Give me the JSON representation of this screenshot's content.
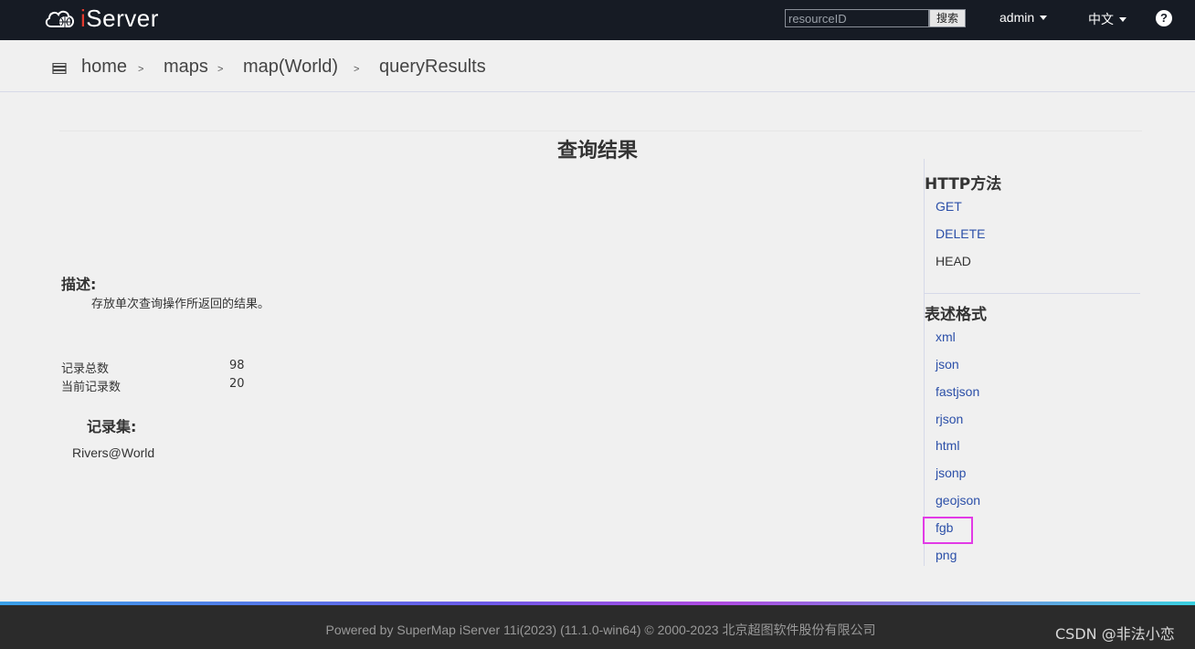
{
  "header": {
    "logo_text": "Server",
    "logo_i": "i",
    "search_placeholder": "resourceID",
    "search_button": "搜索",
    "user_menu": "admin",
    "language_menu": "中文",
    "help_icon": "?"
  },
  "breadcrumb": {
    "items": [
      "home",
      "maps",
      "map(World)",
      "queryResults"
    ],
    "separator": ">"
  },
  "main": {
    "title": "查询结果",
    "description_heading": "描述:",
    "description_text": "存放单次查询操作所返回的结果。",
    "stats": [
      {
        "label": "记录总数",
        "value": "98"
      },
      {
        "label": "当前记录数",
        "value": "20"
      }
    ],
    "records_heading": "记录集:",
    "records": [
      "Rivers@World"
    ]
  },
  "sidebar": {
    "http_heading": "HTTP方法",
    "http_methods": [
      "GET",
      "DELETE",
      "HEAD"
    ],
    "format_heading": "表述格式",
    "formats": [
      "xml",
      "json",
      "fastjson",
      "rjson",
      "html",
      "jsonp",
      "geojson",
      "fgb",
      "png"
    ],
    "highlighted_format": "fgb",
    "highlight_color": "#e23ae6"
  },
  "footer": {
    "text": "Powered by SuperMap iServer 11i(2023) (11.1.0-win64) © 2000-2023 北京超图软件股份有限公司",
    "watermark": "CSDN @非法小恋"
  }
}
